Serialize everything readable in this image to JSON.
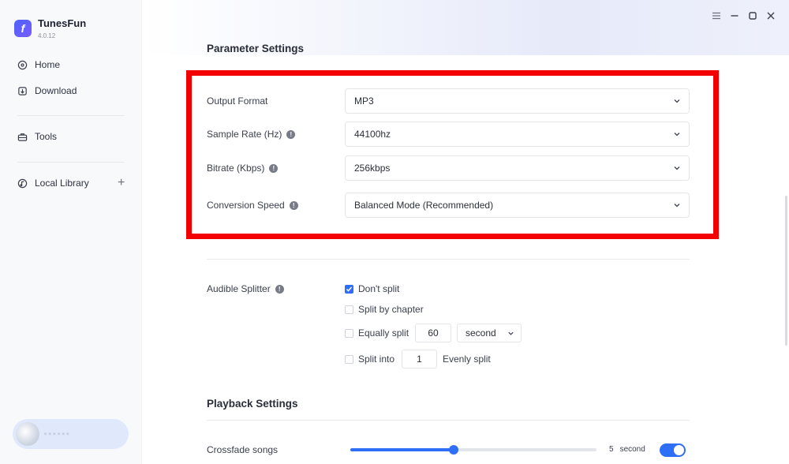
{
  "app": {
    "name": "TunesFun",
    "version": "4.0.12"
  },
  "sidebar": {
    "items": [
      {
        "label": "Home",
        "icon": "home-icon"
      },
      {
        "label": "Download",
        "icon": "download-icon"
      },
      {
        "label": "Tools",
        "icon": "toolbox-icon"
      },
      {
        "label": "Local Library",
        "icon": "music-disc-icon"
      }
    ],
    "user_text": "• • • • • •"
  },
  "parameter_settings": {
    "title": "Parameter Settings",
    "rows": [
      {
        "label": "Output Format",
        "value": "MP3",
        "has_info": false
      },
      {
        "label": "Sample Rate (Hz)",
        "value": "44100hz",
        "has_info": true
      },
      {
        "label": "Bitrate (Kbps)",
        "value": "256kbps",
        "has_info": true
      },
      {
        "label": "Conversion Speed",
        "value": "Balanced Mode (Recommended)",
        "has_info": true
      }
    ]
  },
  "splitter": {
    "label": "Audible Splitter",
    "dont_split": "Don't split",
    "dont_split_checked": true,
    "by_chapter": "Split by chapter",
    "equally": "Equally split",
    "equally_value": "60",
    "equally_unit": "second",
    "into": "Split into",
    "into_value": "1",
    "evenly": "Evenly split"
  },
  "playback": {
    "title": "Playback Settings",
    "crossfade_label": "Crossfade songs",
    "crossfade_value": "5",
    "crossfade_unit": "second",
    "crossfade_fraction": 0.42,
    "crossfade_enabled": true
  },
  "colors": {
    "accent": "#2f6ef6",
    "highlight": "#f20000"
  }
}
